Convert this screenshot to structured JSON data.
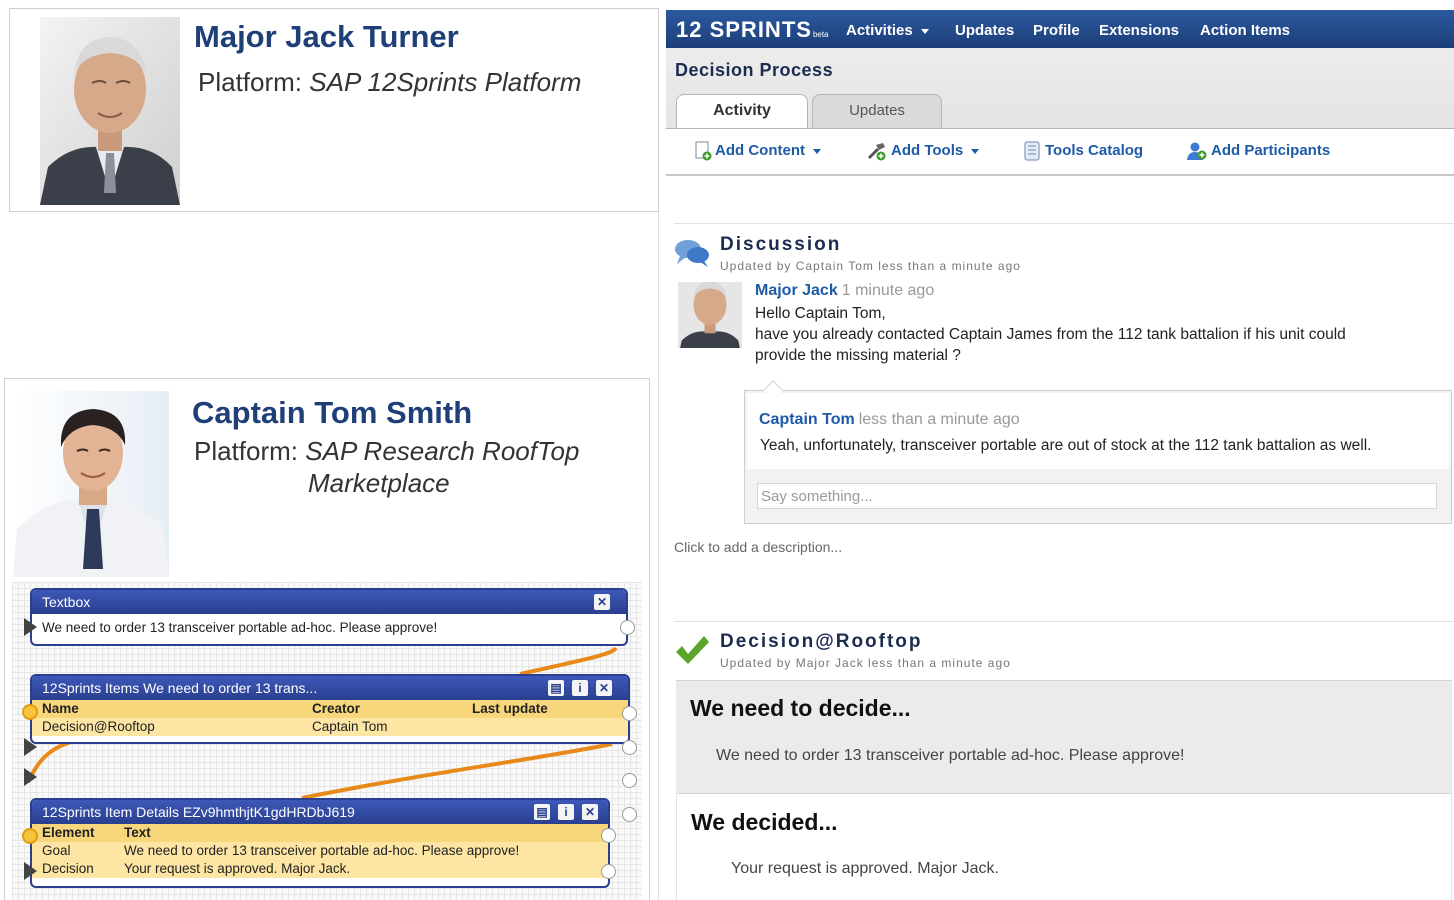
{
  "jack": {
    "name": "Major Jack Turner",
    "platform_label": "Platform:",
    "platform_value": "SAP 12Sprints Platform"
  },
  "tom": {
    "name": "Captain Tom Smith",
    "platform_label": "Platform:",
    "platform_value_line1": "SAP Research RoofTop",
    "platform_value_line2": "Marketplace"
  },
  "mashup": {
    "textbox": {
      "title": "Textbox",
      "content": "We need to order 13 transceiver portable ad-hoc. Please approve!"
    },
    "items": {
      "title": "12Sprints Items We need to order 13 trans...",
      "columns": [
        "Name",
        "Creator",
        "Last update"
      ],
      "rows": [
        {
          "name": "Decision@Rooftop",
          "creator": "Captain Tom",
          "last_update": ""
        }
      ]
    },
    "details": {
      "title": "12Sprints Item Details EZv9hmthjtK1gdHRDbJ619",
      "columns": [
        "Element",
        "Text"
      ],
      "rows": [
        {
          "element": "Goal",
          "text": "We need to order 13 transceiver portable ad-hoc. Please approve!"
        },
        {
          "element": "Decision",
          "text": "Your request is approved. Major Jack."
        }
      ]
    }
  },
  "app": {
    "logo": "12 SPRINTS",
    "logo_badge": "beta",
    "nav": [
      {
        "label": "Activities",
        "has_caret": true
      },
      {
        "label": "Updates"
      },
      {
        "label": "Profile"
      },
      {
        "label": "Extensions"
      },
      {
        "label": "Action Items"
      }
    ],
    "process_title": "Decision Process",
    "tabs": [
      "Activity",
      "Updates"
    ],
    "toolbar": {
      "add_content": "Add Content",
      "add_tools": "Add Tools",
      "tools_catalog": "Tools Catalog",
      "add_participants": "Add Participants"
    },
    "discussion": {
      "title": "Discussion",
      "subtitle": "Updated by Captain Tom less than a minute ago",
      "post": {
        "author": "Major Jack",
        "time": "1 minute ago",
        "lines": [
          "Hello Captain Tom,",
          "have you already contacted Captain James from the 112 tank battalion if his unit could",
          "provide the missing material ?"
        ]
      },
      "reply": {
        "author": "Captain Tom",
        "time": "less than a minute ago",
        "text": "Yeah, unfortunately, transceiver portable are out of stock at the 112 tank battalion as well."
      },
      "input_placeholder": "Say something..."
    },
    "click_description": "Click to add a description...",
    "decision": {
      "title": "Decision@Rooftop",
      "subtitle": "Updated by Major Jack less than a minute ago",
      "need_title": "We need to decide...",
      "need_text": "We need to order 13 transceiver portable ad-hoc. Please approve!",
      "decided_title": "We decided...",
      "decided_text": "Your request is approved. Major Jack."
    }
  },
  "colors": {
    "brand_blue": "#1c3e78",
    "link_blue": "#1e5aa8",
    "widget_blue": "#2a3f8e",
    "row_yellow": "#fde6a4",
    "wire_orange": "#e88a1a",
    "check_green": "#5aa52a"
  }
}
